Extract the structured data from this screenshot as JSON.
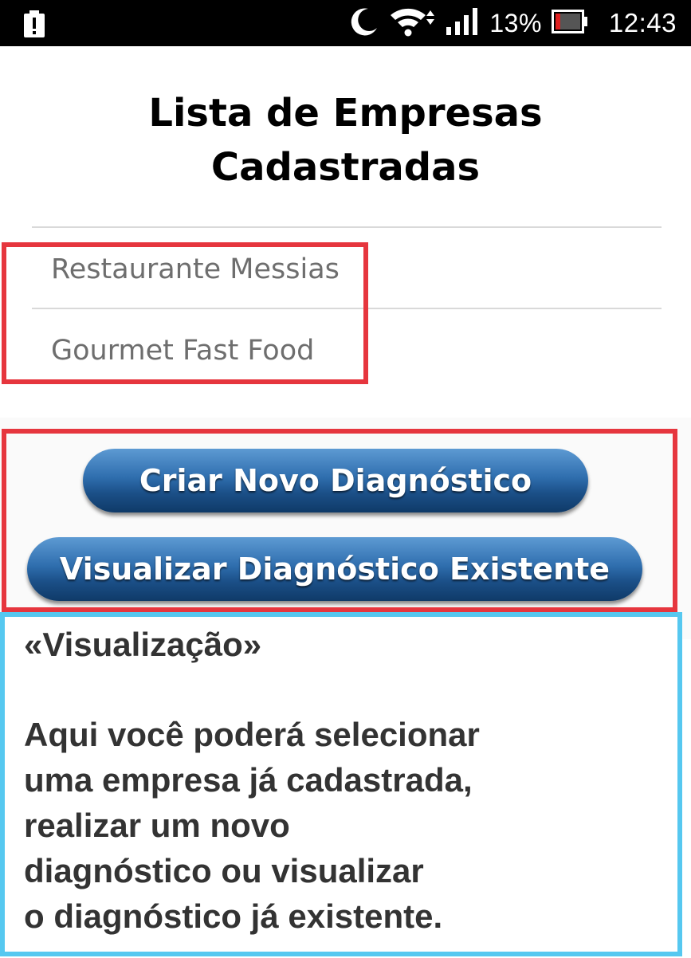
{
  "status_bar": {
    "battery_alert_icon": "battery-alert-icon",
    "dnd_icon": "moon-icon",
    "wifi_icon": "wifi-icon",
    "signal_icon": "signal-icon",
    "battery_percent": "13%",
    "battery_icon": "battery-icon",
    "time": "12:43"
  },
  "page": {
    "title_line1": "Lista de Empresas",
    "title_line2": "Cadastradas"
  },
  "companies": [
    {
      "name": "Restaurante Messias"
    },
    {
      "name": "Gourmet Fast Food"
    }
  ],
  "buttons": {
    "create": "Criar Novo Diagnóstico",
    "view": "Visualizar Diagnóstico Existente"
  },
  "annotation": {
    "heading": "«Visualização»",
    "lines": [
      "Aqui você poderá selecionar",
      "uma empresa já cadastrada,",
      "realizar um novo",
      "diagnóstico ou visualizar",
      "o diagnóstico já existente."
    ]
  },
  "colors": {
    "highlight_red": "#e6363e",
    "highlight_blue": "#56c8f0",
    "button_blue": "#1b4f87"
  }
}
